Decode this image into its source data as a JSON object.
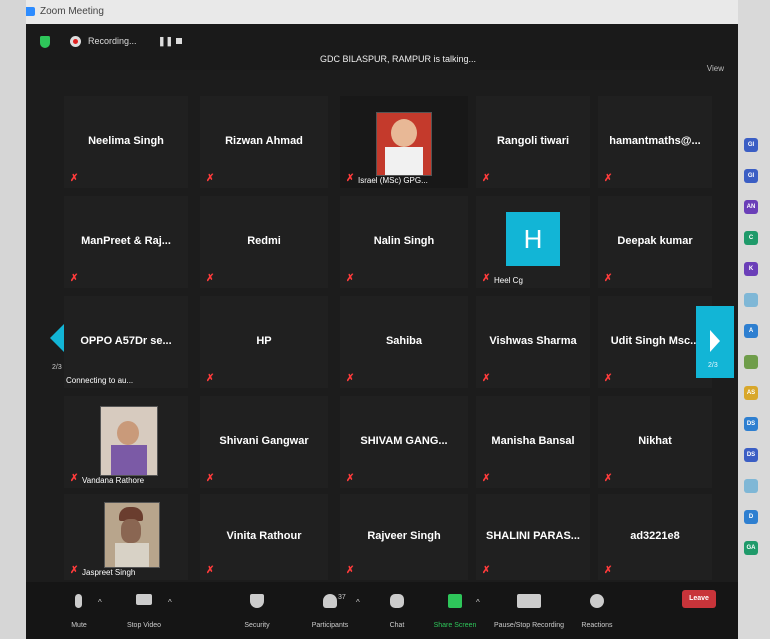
{
  "window": {
    "title": "Zoom Meeting"
  },
  "topbar": {
    "recording_label": "Recording...",
    "talking": "GDC BILASPUR, RAMPUR is talking...",
    "view_label": "View"
  },
  "tiles": [
    [
      "Neelima Singh",
      "Rizwan Ahmad",
      "",
      "Rangoli tiwari",
      "hamantmaths@..."
    ],
    [
      "ManPreet & Raj...",
      "Redmi",
      "Nalin Singh",
      "",
      "Deepak kumar"
    ],
    [
      "OPPO A57Dr se...",
      "HP",
      "Sahiba",
      "Vishwas Sharma",
      "Udit Singh Msc..."
    ],
    [
      "",
      "Shivani Gangwar",
      "SHIVAM GANG...",
      "Manisha Bansal",
      "Nikhat"
    ],
    [
      "",
      "Vinita Rathour",
      "Rajveer Singh",
      "SHALINI PARAS...",
      "ad3221e8"
    ]
  ],
  "captions": {
    "israel": "Israel (MSc) GPG...",
    "heel": "Heel Cg",
    "heel_avatar": "H",
    "connecting": "Connecting to au...",
    "vandana": "Vandana Rathore",
    "jaspreet": "Jaspreet Singh"
  },
  "pages": {
    "left": "2/3",
    "right": "2/3"
  },
  "toolbar": {
    "mute": "Mute",
    "stop_video": "Stop Video",
    "security": "Security",
    "participants": "Participants",
    "participants_count": "37",
    "chat": "Chat",
    "share": "Share Screen",
    "record": "Pause/Stop Recording",
    "reactions": "Reactions",
    "leave": "Leave"
  },
  "sidebar_chips": [
    "GI",
    "GI",
    "AN",
    "C",
    "K",
    "",
    "A",
    "",
    "AS",
    "DS",
    "DS",
    "",
    "D",
    "GA"
  ],
  "colors": {
    "accent": "#12b5d6",
    "leave": "#c8343a",
    "mic_off": "#ff3b3b",
    "shield": "#2ec65a"
  }
}
